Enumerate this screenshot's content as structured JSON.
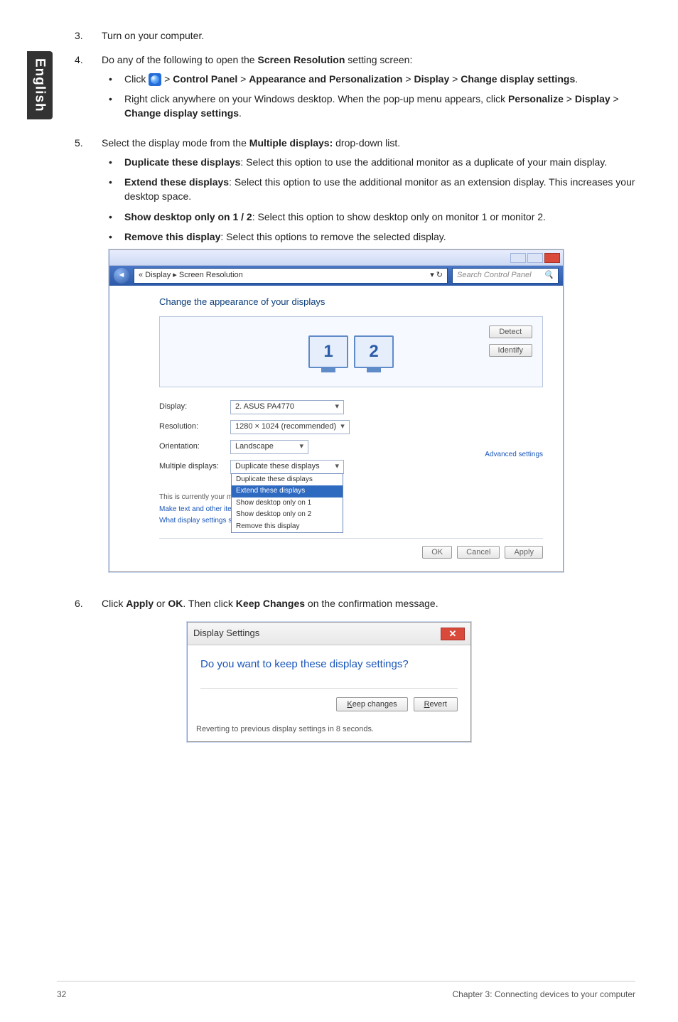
{
  "sideTab": "English",
  "steps": {
    "three": {
      "num": "3.",
      "text": "Turn on your computer."
    },
    "four": {
      "num": "4.",
      "intro_a": "Do any of the following to open the ",
      "intro_b": "Screen Resolution",
      "intro_c": " setting screen:",
      "b1": {
        "prefix": "Click ",
        "cp": "Control Panel",
        "ap": "Appearance and Personalization",
        "disp": "Display",
        "cds": "Change display settings"
      },
      "b2": {
        "line1": "Right click anywhere on your Windows desktop. When the pop-up menu appears, click ",
        "p": "Personalize",
        "d": "Display",
        "cds": "Change display settings"
      }
    },
    "five": {
      "num": "5.",
      "intro_a": "Select the display mode from the ",
      "intro_b": "Multiple displays:",
      "intro_c": " drop-down list.",
      "opts": {
        "dup": {
          "h": "Duplicate these displays",
          "t": ": Select this option to use the additional monitor as a duplicate of your main display."
        },
        "ext": {
          "h": "Extend these displays",
          "t": ": Select this option to use the additional monitor as an extension display. This increases your desktop space."
        },
        "show": {
          "h": "Show desktop only on 1 / 2",
          "t": ": Select this option to show desktop only on monitor 1 or monitor 2."
        },
        "rem": {
          "h": "Remove this display",
          "t": ": Select this options to remove the selected display."
        }
      }
    },
    "six": {
      "num": "6.",
      "a": "Click ",
      "apply": "Apply",
      "or": " or ",
      "ok": "OK",
      "b": ". Then click ",
      "kc": "Keep Changes",
      "c": " on the confirmation message."
    }
  },
  "srWin": {
    "crumb": "« Display ▸ Screen Resolution",
    "searchPH": "Search Control Panel",
    "heading": "Change the appearance of your displays",
    "mon1": "1",
    "mon2": "2",
    "detect": "Detect",
    "identify": "Identify",
    "rows": {
      "display": {
        "lbl": "Display:",
        "val": "2. ASUS PA4770"
      },
      "resolution": {
        "lbl": "Resolution:",
        "val": "1280 × 1024 (recommended)"
      },
      "orientation": {
        "lbl": "Orientation:",
        "val": "Landscape"
      },
      "multiple": {
        "lbl": "Multiple displays:",
        "val": "Duplicate these displays",
        "opts": {
          "o1": "Duplicate these displays",
          "o2": "Extend these displays",
          "o3": "Show desktop only on 1",
          "o4": "Show desktop only on 2",
          "o5": "Remove this display"
        }
      }
    },
    "line1": "This is currently your main display.",
    "line2": "Make text and other items larger or smaller",
    "line3": "What display settings should I choose?",
    "adv": "Advanced settings",
    "ok": "OK",
    "cancel": "Cancel",
    "apply": "Apply"
  },
  "dlg": {
    "title": "Display Settings",
    "msg": "Do you want to keep these display settings?",
    "keep": "Keep changes",
    "revert": "Revert",
    "footer": "Reverting to previous display settings in 8 seconds."
  },
  "footer": {
    "page": "32",
    "chapter": "Chapter 3: Connecting devices to your computer"
  }
}
